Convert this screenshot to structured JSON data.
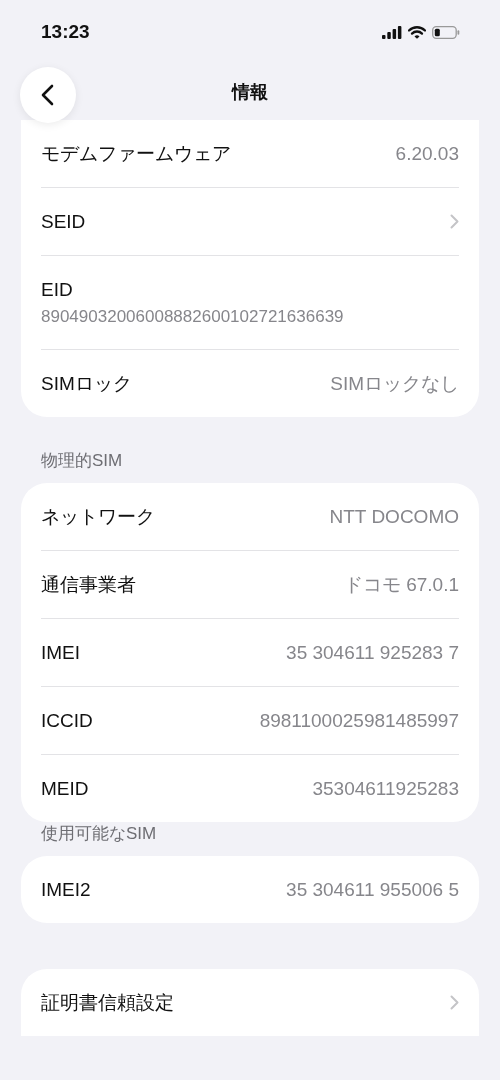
{
  "status_bar": {
    "time": "13:23"
  },
  "nav": {
    "title": "情報"
  },
  "sections": [
    {
      "rows": [
        {
          "kind": "value",
          "label": "モデムファームウェア",
          "value": "6.20.03"
        },
        {
          "kind": "link",
          "label": "SEID"
        },
        {
          "kind": "stacked",
          "label": "EID",
          "value": "89049032006008882600102721636639"
        },
        {
          "kind": "value",
          "label": "SIMロック",
          "value": "SIMロックなし"
        }
      ]
    },
    {
      "header": "物理的SIM",
      "rows": [
        {
          "kind": "value",
          "label": "ネットワーク",
          "value": "NTT DOCOMO"
        },
        {
          "kind": "value",
          "label": "通信事業者",
          "value": "ドコモ 67.0.1"
        },
        {
          "kind": "value",
          "label": "IMEI",
          "value": "35 304611 925283 7"
        },
        {
          "kind": "value",
          "label": "ICCID",
          "value": "8981100025981485997"
        },
        {
          "kind": "value",
          "label": "MEID",
          "value": "35304611925283"
        }
      ]
    },
    {
      "header": "使用可能なSIM",
      "rows": [
        {
          "kind": "value",
          "label": "IMEI2",
          "value": "35 304611 955006 5"
        }
      ]
    },
    {
      "rows": [
        {
          "kind": "link",
          "label": "証明書信頼設定"
        }
      ]
    }
  ]
}
